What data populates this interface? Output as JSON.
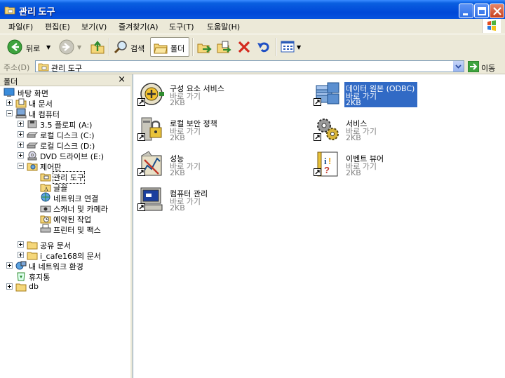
{
  "window": {
    "title": "관리 도구"
  },
  "menubar": {
    "items": [
      "파일(F)",
      "편집(E)",
      "보기(V)",
      "즐겨찾기(A)",
      "도구(T)",
      "도움말(H)"
    ]
  },
  "toolbar": {
    "back_label": "뒤로",
    "search_label": "검색",
    "folders_label": "폴더"
  },
  "address": {
    "label": "주소(D)",
    "value": "관리 도구",
    "go_label": "이동"
  },
  "folders_pane": {
    "title": "폴더",
    "close": "×",
    "tree": [
      {
        "label": "바탕 화면"
      },
      {
        "label": "내 문서"
      },
      {
        "label": "내 컴퓨터"
      },
      {
        "label": "3.5 플로피 (A:)"
      },
      {
        "label": "로컬 디스크 (C:)"
      },
      {
        "label": "로컬 디스크 (D:)"
      },
      {
        "label": "DVD 드라이브 (E:)"
      },
      {
        "label": "제어판"
      },
      {
        "label": "관리 도구"
      },
      {
        "label": "글꼴"
      },
      {
        "label": "네트워크 연결"
      },
      {
        "label": "스캐너 및 카메라"
      },
      {
        "label": "예약된 작업"
      },
      {
        "label": "프린터 및 팩스"
      },
      {
        "label": "공유 문서"
      },
      {
        "label": "i_cafe168의 문서"
      },
      {
        "label": "내 네트워크 환경"
      },
      {
        "label": "휴지통"
      },
      {
        "label": "db"
      }
    ]
  },
  "content": {
    "items": [
      {
        "name": "구성 요소 서비스",
        "type": "바로 가기",
        "size": "2KB"
      },
      {
        "name": "데이터 원본 (ODBC)",
        "type": "바로 가기",
        "size": "2KB"
      },
      {
        "name": "로컬 보안 정책",
        "type": "바로 가기",
        "size": "2KB"
      },
      {
        "name": "서비스",
        "type": "바로 가기",
        "size": "2KB"
      },
      {
        "name": "성능",
        "type": "바로 가기",
        "size": "2KB"
      },
      {
        "name": "이벤트 뷰어",
        "type": "바로 가기",
        "size": "2KB"
      },
      {
        "name": "컴퓨터 관리",
        "type": "바로 가기",
        "size": "2KB"
      }
    ]
  },
  "colors": {
    "titlebar": "#0048D8",
    "selection": "#316AC5",
    "chrome": "#ECE9D8"
  }
}
